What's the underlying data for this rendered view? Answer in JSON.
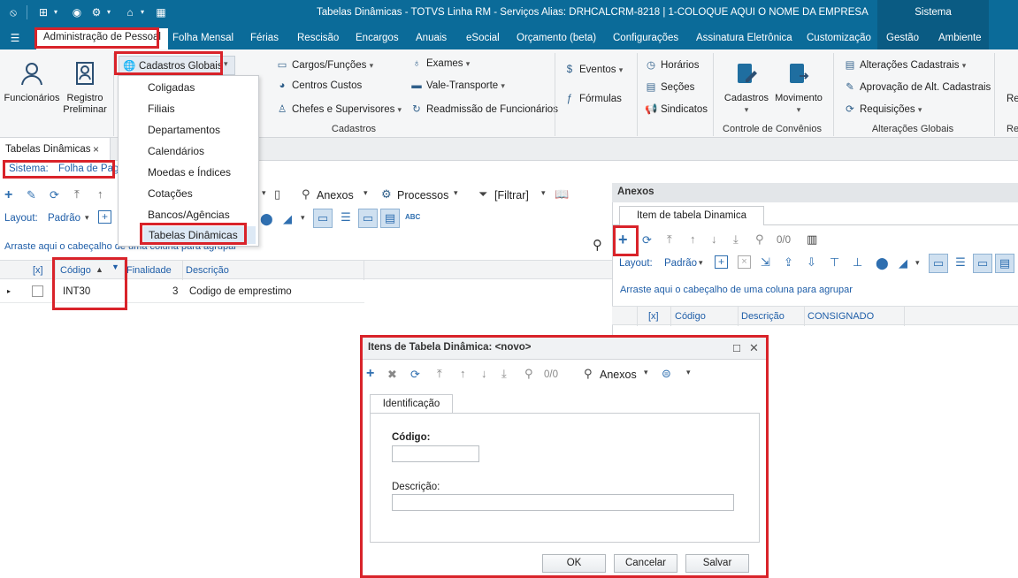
{
  "window": {
    "title": "Tabelas Dinâmicas - TOTVS Linha RM - Serviços  Alias: DRHCALCRM-8218 | 1-COLOQUE AQUI O NOME DA EMPRESA",
    "system_label": "Sistema"
  },
  "menubar": {
    "items": [
      {
        "label": "Administração de Pessoal"
      },
      {
        "label": "Folha Mensal"
      },
      {
        "label": "Férias"
      },
      {
        "label": "Rescisão"
      },
      {
        "label": "Encargos"
      },
      {
        "label": "Anuais"
      },
      {
        "label": "eSocial"
      },
      {
        "label": "Orçamento (beta)"
      },
      {
        "label": "Configurações"
      },
      {
        "label": "Assinatura Eletrônica"
      },
      {
        "label": "Customização"
      },
      {
        "label": "Gestão"
      },
      {
        "label": "Ambiente"
      }
    ]
  },
  "ribbon": {
    "funcionarios": "Funcionários",
    "registro_line1": "Registro",
    "registro_line2": "Preliminar",
    "cadastros_globais": "Cadastros Globais",
    "cargos": "Cargos/Funções",
    "centros": "Centros Custos",
    "chefes": "Chefes e Supervisores",
    "exames": "Exames",
    "vale": "Vale-Transporte",
    "readmissao": "Readmissão de Funcionários",
    "eventos": "Eventos",
    "formulas": "Fórmulas",
    "horarios": "Horários",
    "secoes": "Seções",
    "sindicatos": "Sindicatos",
    "cadastros_big": "Cadastros",
    "movimento_big": "Movimento",
    "alteracoes": "Alterações Cadastrais",
    "aprovacao": "Aprovação de Alt. Cadastrais",
    "requisicoes": "Requisições",
    "group_cadastros": "Cadastros",
    "group_convenios": "Controle de Convênios",
    "group_alteracoes": "Alterações Globais",
    "trunc1": "Re",
    "trunc2": "Re"
  },
  "dropdown": {
    "items": [
      {
        "label": "Coligadas"
      },
      {
        "label": "Filiais"
      },
      {
        "label": "Departamentos"
      },
      {
        "label": "Calendários"
      },
      {
        "label": "Moedas e Índices"
      },
      {
        "label": "Cotações"
      },
      {
        "label": "Bancos/Agências"
      },
      {
        "label": "Tabelas Dinâmicas"
      }
    ]
  },
  "doc_tab": {
    "label": "Tabelas Dinâmicas",
    "close": "×"
  },
  "sistema": {
    "label": "Sistema:",
    "value": "Folha de Pag"
  },
  "left_toolbar": {
    "anexos": "Anexos",
    "processos": "Processos",
    "filtrar": "[Filtrar]",
    "layout_label": "Layout:",
    "layout_value": "Padrão",
    "group_hint": "Arraste aqui o cabeçalho de uma coluna para agrupar"
  },
  "left_grid": {
    "columns": [
      "[x]",
      "Código",
      "Finalidade",
      "Descrição"
    ],
    "rows": [
      {
        "codigo": "INT30",
        "finalidade": "3",
        "descricao": "Codigo de emprestimo"
      }
    ]
  },
  "anexos_panel": {
    "title": "Anexos",
    "tab": "Item de tabela Dinamica",
    "counter": "0/0",
    "layout_label": "Layout:",
    "layout_value": "Padrão",
    "group_hint": "Arraste aqui o cabeçalho de uma coluna para agrupar",
    "columns": [
      "[x]",
      "Código",
      "Descrição",
      "CONSIGNADO"
    ]
  },
  "modal": {
    "title": "Itens de Tabela Dinâmica: <novo>",
    "counter": "0/0",
    "anexos": "Anexos",
    "tab": "Identificação",
    "codigo_label": "Código:",
    "codigo_value": "",
    "descricao_label": "Descrição:",
    "descricao_value": "",
    "ok": "OK",
    "cancelar": "Cancelar",
    "salvar": "Salvar"
  },
  "colors": {
    "brand_blue": "#0b6b99",
    "highlight_red": "#d9232a",
    "link_blue": "#1f5ea8"
  }
}
